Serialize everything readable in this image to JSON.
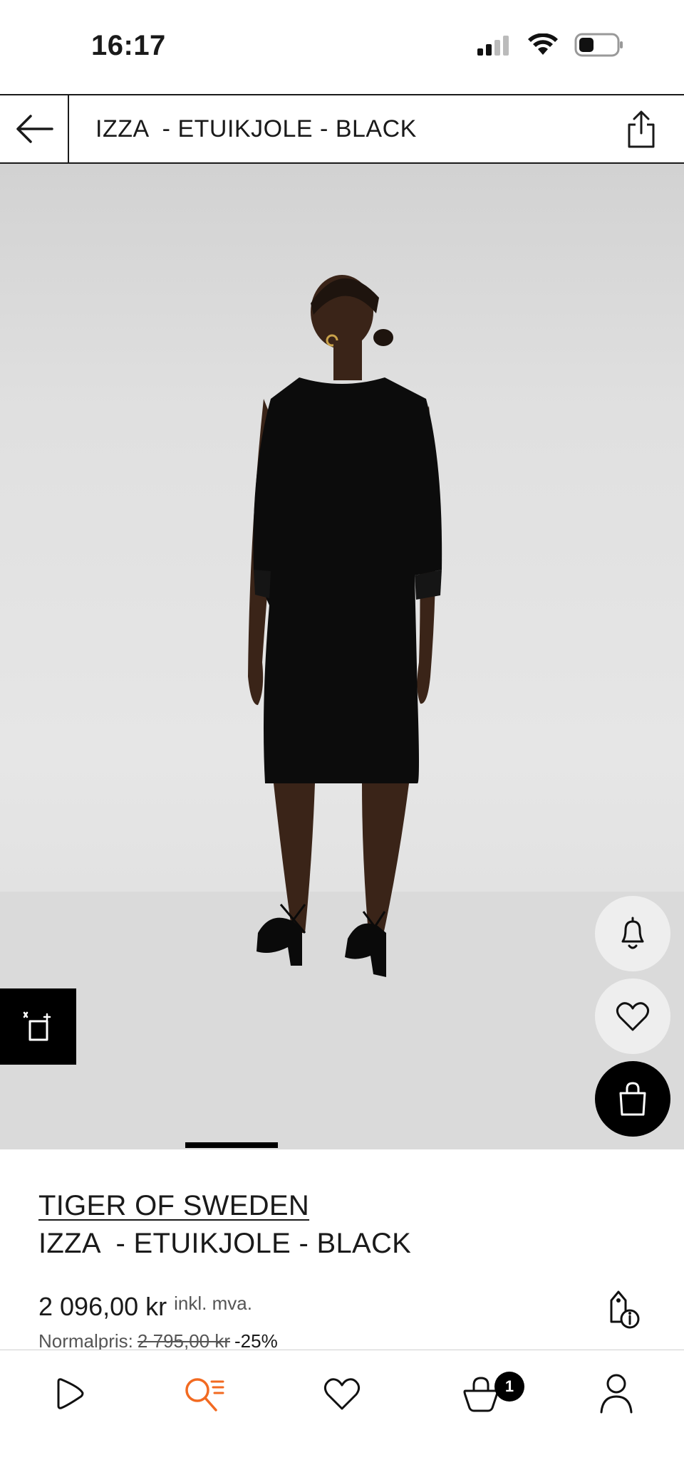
{
  "status_bar": {
    "time": "16:17"
  },
  "header": {
    "title": "IZZA  - ETUIKJOLE - BLACK",
    "back_icon": "arrow-left-icon",
    "share_icon": "share-icon"
  },
  "gallery": {
    "fab_icons": [
      "bell-icon",
      "heart-icon",
      "shopping-bag-icon"
    ],
    "feedback_icon": "feedback-icon",
    "active_image": 1
  },
  "product": {
    "brand": "TIGER OF SWEDEN",
    "name": "IZZA  - ETUIKJOLE - BLACK",
    "price": "2 096,00 kr",
    "vat_note": "inkl. mva.",
    "normal_label": "Normalpris:",
    "normal_price": "2 795,00 kr",
    "discount": "-25%"
  },
  "bottom_nav": {
    "items": [
      {
        "id": "home",
        "icon": "play-home-icon"
      },
      {
        "id": "search",
        "icon": "search-list-icon",
        "active": true
      },
      {
        "id": "wishlist",
        "icon": "heart-icon"
      },
      {
        "id": "bag",
        "icon": "shopping-bag-icon",
        "badge": "1"
      },
      {
        "id": "account",
        "icon": "user-icon"
      }
    ]
  },
  "colors": {
    "accent": "#f26a21",
    "text": "#1a1a1a",
    "image_bg": "#e2e2e2"
  }
}
